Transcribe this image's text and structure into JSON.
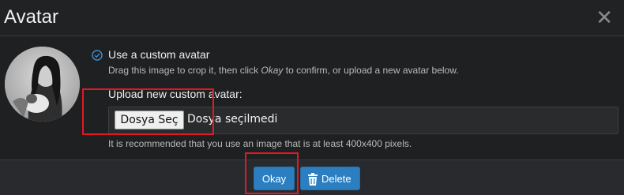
{
  "dialog": {
    "title": "Avatar",
    "close_glyph": "✕"
  },
  "avatar": {
    "icon": "user-avatar-photo"
  },
  "option": {
    "label": "Use a custom avatar",
    "hint_part1": "Drag this image to crop it, then click ",
    "hint_em": "Okay",
    "hint_part2": " to confirm, or upload a new avatar below."
  },
  "upload": {
    "label": "Upload new custom avatar:",
    "button_label": "Dosya Seç",
    "status": "Dosya seçilmedi",
    "recommendation": "It is recommended that you use an image that is at least 400x400 pixels."
  },
  "footer": {
    "okay_label": "Okay",
    "delete_label": "Delete"
  },
  "colors": {
    "accent": "#2b7fc0",
    "annotation": "#e11a22",
    "background": "#1f2022"
  }
}
